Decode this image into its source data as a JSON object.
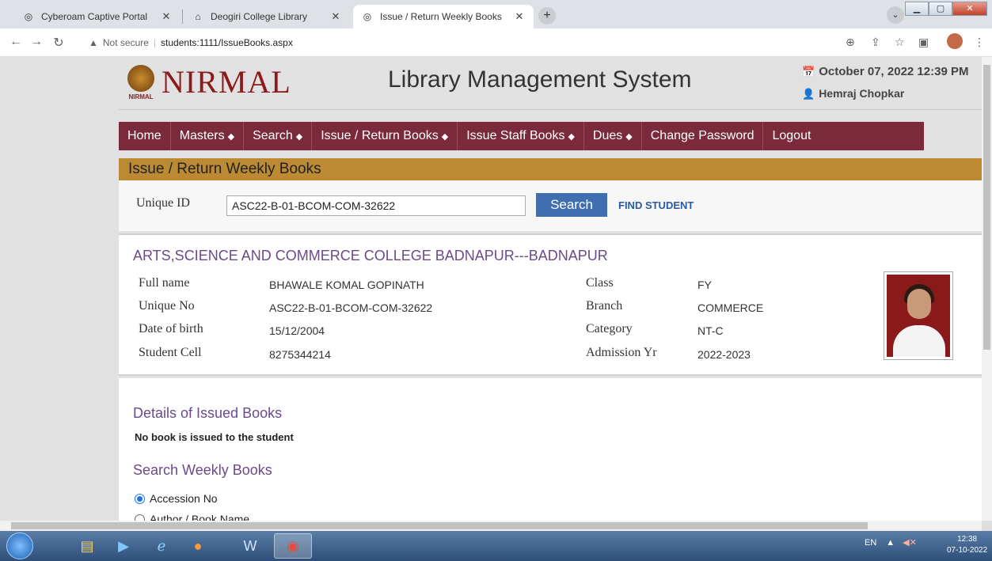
{
  "browser": {
    "tabs": [
      {
        "label": "Cyberoam Captive Portal",
        "icon": "globe-icon",
        "active": false
      },
      {
        "label": "Deogiri College Library",
        "icon": "library-icon",
        "active": false
      },
      {
        "label": "Issue / Return Weekly Books",
        "icon": "globe-icon",
        "active": true
      }
    ],
    "security_label": "Not secure",
    "url": "students:1111/IssueBooks.aspx"
  },
  "header": {
    "brand": "NIRMAL",
    "brand_small": "NIRMAL",
    "system_title": "Library Management System",
    "datetime": "October 07, 2022 12:39 PM",
    "user": "Hemraj Chopkar"
  },
  "menu": [
    {
      "label": "Home",
      "has_caret": false
    },
    {
      "label": "Masters",
      "has_caret": true
    },
    {
      "label": "Search",
      "has_caret": true
    },
    {
      "label": "Issue / Return Books",
      "has_caret": true
    },
    {
      "label": "Issue Staff Books",
      "has_caret": true
    },
    {
      "label": "Dues",
      "has_caret": true
    },
    {
      "label": "Change Password",
      "has_caret": false
    },
    {
      "label": "Logout",
      "has_caret": false
    }
  ],
  "page_title": "Issue / Return Weekly Books",
  "search": {
    "label": "Unique ID",
    "value": "ASC22-B-01-BCOM-COM-32622",
    "button": "Search",
    "find_link": "FIND STUDENT"
  },
  "student": {
    "college": "ARTS,SCIENCE AND COMMERCE COLLEGE BADNAPUR---BADNAPUR",
    "fields_left": [
      {
        "label": "Full name",
        "value": "BHAWALE KOMAL GOPINATH"
      },
      {
        "label": "Unique No",
        "value": "ASC22-B-01-BCOM-COM-32622"
      },
      {
        "label": "Date of birth",
        "value": "15/12/2004"
      },
      {
        "label": "Student Cell",
        "value": "8275344214"
      }
    ],
    "fields_right": [
      {
        "label": "Class",
        "value": "FY"
      },
      {
        "label": "Branch",
        "value": "COMMERCE"
      },
      {
        "label": "Category",
        "value": "NT-C"
      },
      {
        "label": "Admission Yr",
        "value": "2022-2023"
      }
    ]
  },
  "issued": {
    "title": "Details of Issued Books",
    "message": "No book is issued to the student",
    "search_title": "Search Weekly Books",
    "options": [
      {
        "label": "Accession No",
        "checked": true
      },
      {
        "label": "Author / Book Name",
        "checked": false
      }
    ]
  },
  "taskbar": {
    "lang": "EN",
    "time": "12:38",
    "date": "07-10-2022"
  }
}
